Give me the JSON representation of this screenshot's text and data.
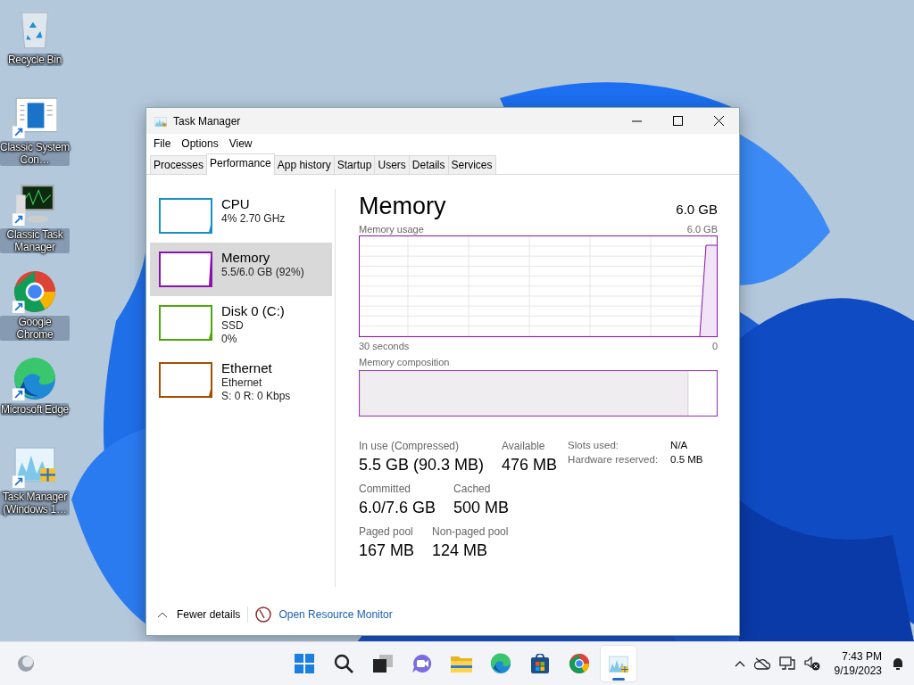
{
  "desktop_icons": [
    {
      "kind": "recycle",
      "label": "Recycle Bin",
      "shortcut": false
    },
    {
      "kind": "sysconfig",
      "label": "Classic System Con…",
      "shortcut": true
    },
    {
      "kind": "monitor",
      "label": "Classic Task Manager",
      "shortcut": true
    },
    {
      "kind": "chrome",
      "label": "Google Chrome",
      "shortcut": true
    },
    {
      "kind": "edge",
      "label": "Microsoft Edge",
      "shortcut": true
    },
    {
      "kind": "taskmgr",
      "label": "Task Manager (Windows 1…",
      "shortcut": true
    }
  ],
  "window": {
    "title": "Task Manager",
    "menu": [
      "File",
      "Options",
      "View"
    ],
    "tabs": [
      {
        "label": "Processes",
        "selected": false
      },
      {
        "label": "Performance",
        "selected": true
      },
      {
        "label": "App history",
        "selected": false
      },
      {
        "label": "Startup",
        "selected": false
      },
      {
        "label": "Users",
        "selected": false
      },
      {
        "label": "Details",
        "selected": false
      },
      {
        "label": "Services",
        "selected": false
      }
    ],
    "sidebar": {
      "items": [
        {
          "name": "CPU",
          "lines": [
            "4%  2.70 GHz"
          ],
          "color": "#1a8fc7",
          "selected": false
        },
        {
          "name": "Memory",
          "lines": [
            "5.5/6.0 GB (92%)"
          ],
          "color": "#8b12ae",
          "selected": true
        },
        {
          "name": "Disk 0 (C:)",
          "lines": [
            "SSD",
            "0%"
          ],
          "color": "#4da60c",
          "selected": false
        },
        {
          "name": "Ethernet",
          "lines": [
            "Ethernet",
            "S: 0 R: 0 Kbps"
          ],
          "color": "#a74f01",
          "selected": false
        }
      ]
    },
    "detail": {
      "title": "Memory",
      "total": "6.0 GB",
      "usage_graph": {
        "label": "Memory usage",
        "max": "6.0 GB",
        "time_start": "30 seconds",
        "time_end": "0"
      },
      "composition": {
        "label": "Memory composition",
        "level": 0.92
      },
      "stat_rows": [
        {
          "items": [
            {
              "label": "In use (Compressed)",
              "value": "5.5 GB (90.3 MB)"
            },
            {
              "label": "Available",
              "value": "476 MB"
            }
          ]
        },
        {
          "items": [
            {
              "label": "Committed",
              "value": "6.0/7.6 GB"
            },
            {
              "label": "Cached",
              "value": "500 MB"
            }
          ]
        },
        {
          "items": [
            {
              "label": "Paged pool",
              "value": "167 MB"
            },
            {
              "label": "Non-paged pool",
              "value": "124 MB"
            }
          ]
        }
      ],
      "hardware": [
        {
          "label": "Slots used:",
          "value": "N/A"
        },
        {
          "label": "Hardware reserved:",
          "value": "0.5 MB"
        }
      ]
    },
    "footer": {
      "fewer_details": "Fewer details",
      "link": "Open Resource Monitor"
    }
  },
  "taskbar": {
    "apps": [
      {
        "kind": "start",
        "selected": false
      },
      {
        "kind": "search",
        "selected": false
      },
      {
        "kind": "taskview",
        "selected": false
      },
      {
        "kind": "chat",
        "selected": false
      },
      {
        "kind": "explorer",
        "selected": false
      },
      {
        "kind": "edge",
        "selected": false
      },
      {
        "kind": "store",
        "selected": false
      },
      {
        "kind": "chrome",
        "selected": false
      },
      {
        "kind": "taskmgr",
        "selected": true
      }
    ],
    "time": "7:43 PM",
    "date": "9/19/2023"
  }
}
